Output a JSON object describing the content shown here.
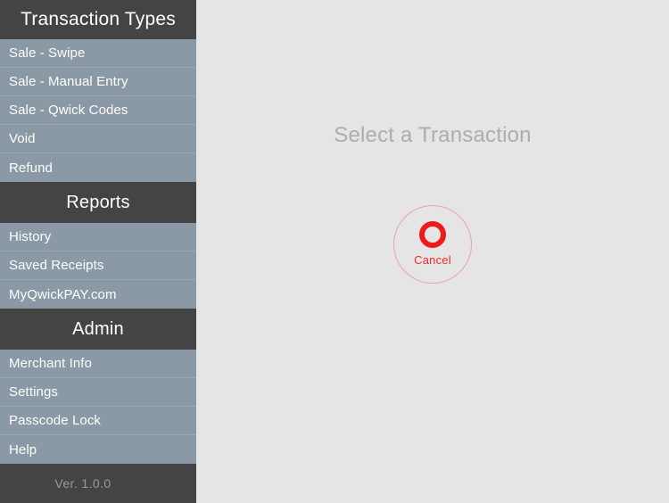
{
  "sidebar": {
    "sections": [
      {
        "title": "Transaction Types",
        "items": [
          {
            "label": "Sale - Swipe"
          },
          {
            "label": "Sale - Manual Entry"
          },
          {
            "label": "Sale - Qwick Codes"
          },
          {
            "label": "Void"
          },
          {
            "label": "Refund"
          }
        ]
      },
      {
        "title": "Reports",
        "items": [
          {
            "label": "History"
          },
          {
            "label": "Saved Receipts"
          },
          {
            "label": "MyQwickPAY.com"
          }
        ]
      },
      {
        "title": "Admin",
        "items": [
          {
            "label": "Merchant Info"
          },
          {
            "label": "Settings"
          },
          {
            "label": "Passcode Lock"
          },
          {
            "label": "Help"
          }
        ]
      }
    ],
    "version": "Ver. 1.0.0"
  },
  "main": {
    "prompt": "Select a Transaction",
    "cancel": {
      "label": "Cancel",
      "icon": "cancel-ring-icon"
    }
  },
  "colors": {
    "sidebar_background": "#8b98a5",
    "section_header_background": "#444444",
    "content_background": "#e5e5e5",
    "cancel_accent": "#ee1b1b",
    "prompt_text": "#adadad"
  }
}
